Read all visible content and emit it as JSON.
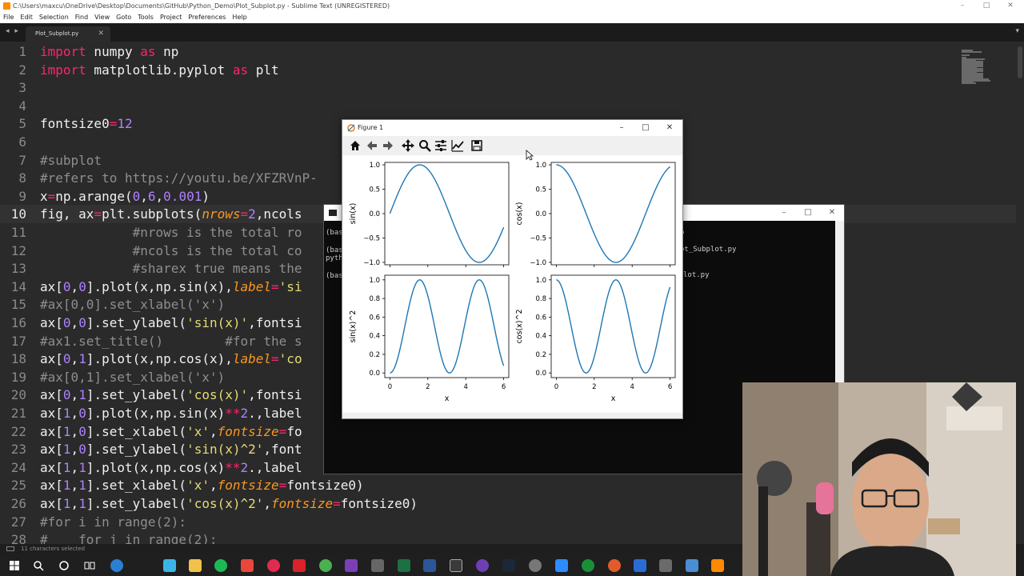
{
  "window": {
    "title": "C:\\Users\\maxcu\\OneDrive\\Desktop\\Documents\\GitHub\\Python_Demo\\Plot_Subplot.py - Sublime Text (UNREGISTERED)",
    "minimize": "–",
    "maximize": "□",
    "close": "✕"
  },
  "menu": [
    "File",
    "Edit",
    "Selection",
    "Find",
    "View",
    "Goto",
    "Tools",
    "Project",
    "Preferences",
    "Help"
  ],
  "tabs": {
    "nav": "◂ ▸",
    "active": "Plot_Subplot.py",
    "close": "✕",
    "more": "▾"
  },
  "editor": {
    "current_line": 10,
    "lines": [
      {
        "n": "1",
        "t": "import numpy as np"
      },
      {
        "n": "2",
        "t": "import matplotlib.pyplot as plt"
      },
      {
        "n": "3",
        "t": ""
      },
      {
        "n": "4",
        "t": ""
      },
      {
        "n": "5",
        "t": "fontsize0=12"
      },
      {
        "n": "6",
        "t": ""
      },
      {
        "n": "7",
        "t": "#subplot"
      },
      {
        "n": "8",
        "t": "#refers to https://youtu.be/XFZRVnP-"
      },
      {
        "n": "9",
        "t": "x=np.arange(0,6,0.001)"
      },
      {
        "n": "10",
        "t": "fig, ax=plt.subplots(nrows=2,ncols"
      },
      {
        "n": "11",
        "t": "            #nrows is the total ro"
      },
      {
        "n": "12",
        "t": "            #ncols is the total co"
      },
      {
        "n": "13",
        "t": "            #sharex true means the"
      },
      {
        "n": "14",
        "t": "ax[0,0].plot(x,np.sin(x),label='si"
      },
      {
        "n": "15",
        "t": "#ax[0,0].set_xlabel('x')"
      },
      {
        "n": "16",
        "t": "ax[0,0].set_ylabel('sin(x)',fontsi"
      },
      {
        "n": "17",
        "t": "#ax1.set_title()        #for the s"
      },
      {
        "n": "18",
        "t": "ax[0,1].plot(x,np.cos(x),label='co"
      },
      {
        "n": "19",
        "t": "#ax[0,1].set_xlabel('x')"
      },
      {
        "n": "20",
        "t": "ax[0,1].set_ylabel('cos(x)',fontsi"
      },
      {
        "n": "21",
        "t": "ax[1,0].plot(x,np.sin(x)**2.,label"
      },
      {
        "n": "22",
        "t": "ax[1,0].set_xlabel('x',fontsize=fo"
      },
      {
        "n": "23",
        "t": "ax[1,0].set_ylabel('sin(x)^2',font"
      },
      {
        "n": "24",
        "t": "ax[1,1].plot(x,np.cos(x)**2.,label"
      },
      {
        "n": "25",
        "t": "ax[1,1].set_xlabel('x',fontsize=fontsize0)"
      },
      {
        "n": "26",
        "t": "ax[1,1].set_ylabel('cos(x)^2',fontsize=fontsize0)"
      },
      {
        "n": "27",
        "t": "#for i in range(2):"
      },
      {
        "n": "28",
        "t": "#    for j in range(2):"
      }
    ]
  },
  "status": {
    "text": "11 characters selected"
  },
  "console": {
    "lines": [
      "(bas",
      "(bas",
      "pyth",
      "(bas"
    ],
    "right_lines": [
      "o",
      "ot_Subplot.py",
      "lot.py"
    ]
  },
  "figure": {
    "title": "Figure 1",
    "toolbar": [
      "home-icon",
      "back-icon",
      "forward-icon",
      "pan-icon",
      "zoom-icon",
      "configure-subplots-icon",
      "edit-axes-icon",
      "save-icon"
    ],
    "colors": {
      "line": "#1f77b4"
    }
  },
  "chart_data": [
    {
      "type": "line",
      "function": "sin(x)",
      "x_range": [
        0,
        6
      ],
      "ylabel": "sin(x)",
      "xlabel": "",
      "ylim": [
        -1.05,
        1.05
      ],
      "yticks": [
        "1.0",
        "0.5",
        "0.0",
        "−0.5",
        "−1.0"
      ],
      "xticks": [],
      "x": [
        0,
        0.5,
        1,
        1.5,
        2,
        2.5,
        3,
        3.5,
        4,
        4.5,
        5,
        5.5,
        6
      ],
      "y": [
        0,
        0.48,
        0.84,
        1.0,
        0.91,
        0.6,
        0.14,
        -0.35,
        -0.76,
        -0.98,
        -0.96,
        -0.71,
        -0.28
      ]
    },
    {
      "type": "line",
      "function": "cos(x)",
      "x_range": [
        0,
        6
      ],
      "ylabel": "cos(x)",
      "xlabel": "",
      "ylim": [
        -1.05,
        1.05
      ],
      "yticks": [
        "1.0",
        "0.5",
        "0.0",
        "−0.5",
        "−1.0"
      ],
      "xticks": [],
      "x": [
        0,
        0.5,
        1,
        1.5,
        2,
        2.5,
        3,
        3.5,
        4,
        4.5,
        5,
        5.5,
        6
      ],
      "y": [
        1.0,
        0.88,
        0.54,
        0.07,
        -0.42,
        -0.8,
        -0.99,
        -0.94,
        -0.65,
        -0.21,
        0.28,
        0.71,
        0.96
      ]
    },
    {
      "type": "line",
      "function": "sin(x)^2",
      "x_range": [
        0,
        6
      ],
      "ylabel": "sin(x)^2",
      "xlabel": "x",
      "ylim": [
        -0.05,
        1.05
      ],
      "yticks": [
        "1.0",
        "0.8",
        "0.6",
        "0.4",
        "0.2",
        "0.0"
      ],
      "xticks": [
        "0",
        "2",
        "4",
        "6"
      ],
      "x": [
        0,
        0.5,
        1,
        1.5,
        2,
        2.5,
        3,
        3.5,
        4,
        4.5,
        5,
        5.5,
        6
      ],
      "y": [
        0,
        0.23,
        0.71,
        0.99,
        0.83,
        0.36,
        0.02,
        0.12,
        0.57,
        0.96,
        0.92,
        0.5,
        0.08
      ]
    },
    {
      "type": "line",
      "function": "cos(x)^2",
      "x_range": [
        0,
        6
      ],
      "ylabel": "cos(x)^2",
      "xlabel": "x",
      "ylim": [
        -0.05,
        1.05
      ],
      "yticks": [
        "1.0",
        "0.8",
        "0.6",
        "0.4",
        "0.2",
        "0.0"
      ],
      "xticks": [
        "0",
        "2",
        "4",
        "6"
      ],
      "x": [
        0,
        0.5,
        1,
        1.5,
        2,
        2.5,
        3,
        3.5,
        4,
        4.5,
        5,
        5.5,
        6
      ],
      "y": [
        1.0,
        0.77,
        0.29,
        0.01,
        0.17,
        0.64,
        0.98,
        0.88,
        0.43,
        0.04,
        0.08,
        0.5,
        0.92
      ]
    }
  ]
}
